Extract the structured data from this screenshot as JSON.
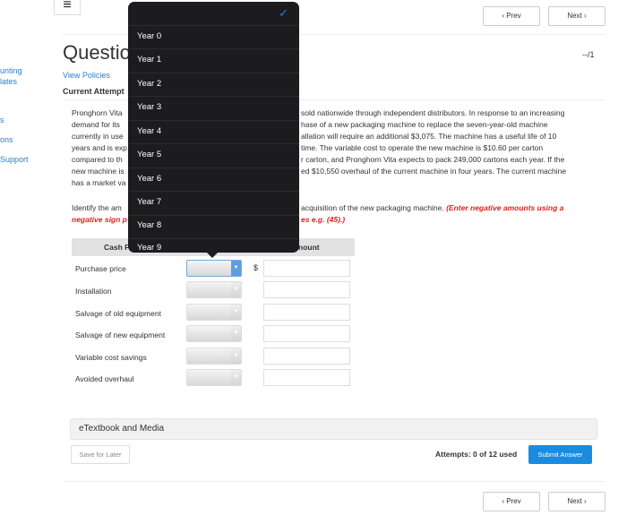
{
  "sidebar": {
    "items": [
      "unting",
      "lates",
      "s",
      "ons",
      "Support"
    ]
  },
  "header": {
    "menu_icon": "hamburger-icon",
    "prev": "‹  Prev",
    "next": "Next  ›",
    "title": "Questio",
    "score": "--/1",
    "view_policies": "View Policies",
    "current_attempt": "Current Attempt"
  },
  "problem": {
    "left": [
      "Pronghorn Vita",
      "demand for its",
      "currently in use",
      "years and is exp",
      "compared to th",
      "new machine is",
      "has a market va"
    ],
    "right": [
      "sold nationwide through independent distributors. In response to an increasing",
      "hase of a new packaging machine to replace the seven-year-old machine",
      "allation will require an additional $3,075. The machine has a useful life of 10",
      "time. The variable cost to operate the new machine is $10.60 per carton",
      "r carton, and Pronghorn Vita expects to pack 249,000 cartons each year. If the",
      "ed $10,550 overhaul of the current machine in four years. The current machine",
      ""
    ],
    "instr_left": "Identify the am",
    "instr_right": "acquisition of the new packaging machine.",
    "instr_red_right": "(Enter negative amounts using a",
    "red_left": "negative sign p",
    "red_right": "es e.g. (45).)"
  },
  "table": {
    "col1": "Cash F",
    "col3": "nount",
    "currency": "$",
    "rows": [
      "Purchase price",
      "Installation",
      "Salvage of old equipment",
      "Salvage of new equipment",
      "Variable cost savings",
      "Avoided overhaul"
    ]
  },
  "dropdown": {
    "checked_icon": "checkmark-icon",
    "options": [
      "Year 0",
      "Year 1",
      "Year 2",
      "Year 3",
      "Year 4",
      "Year 5",
      "Year 6",
      "Year 7",
      "Year 8",
      "Year 9"
    ],
    "accent": "#0a84ff"
  },
  "footer": {
    "etextbook": "eTextbook and Media",
    "save": "Save for Later",
    "attempts": "Attempts: 0 of 12 used",
    "submit": "Submit Answer",
    "submit_color": "#1a8ce0"
  }
}
